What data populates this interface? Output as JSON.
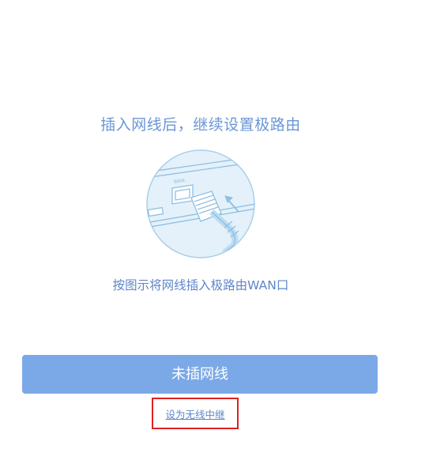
{
  "setup": {
    "title": "插入网线后，继续设置极路由",
    "instruction": "按图示将网线插入极路由WAN口",
    "illustration_port_label": "WAN",
    "status_button_label": "未插网线",
    "repeater_link_label": "设为无线中继"
  },
  "colors": {
    "accent_text": "#6a96d6",
    "button_background": "#7ba9e8",
    "highlight_border": "#e02020",
    "illustration_circle": "#e4f1fa"
  }
}
